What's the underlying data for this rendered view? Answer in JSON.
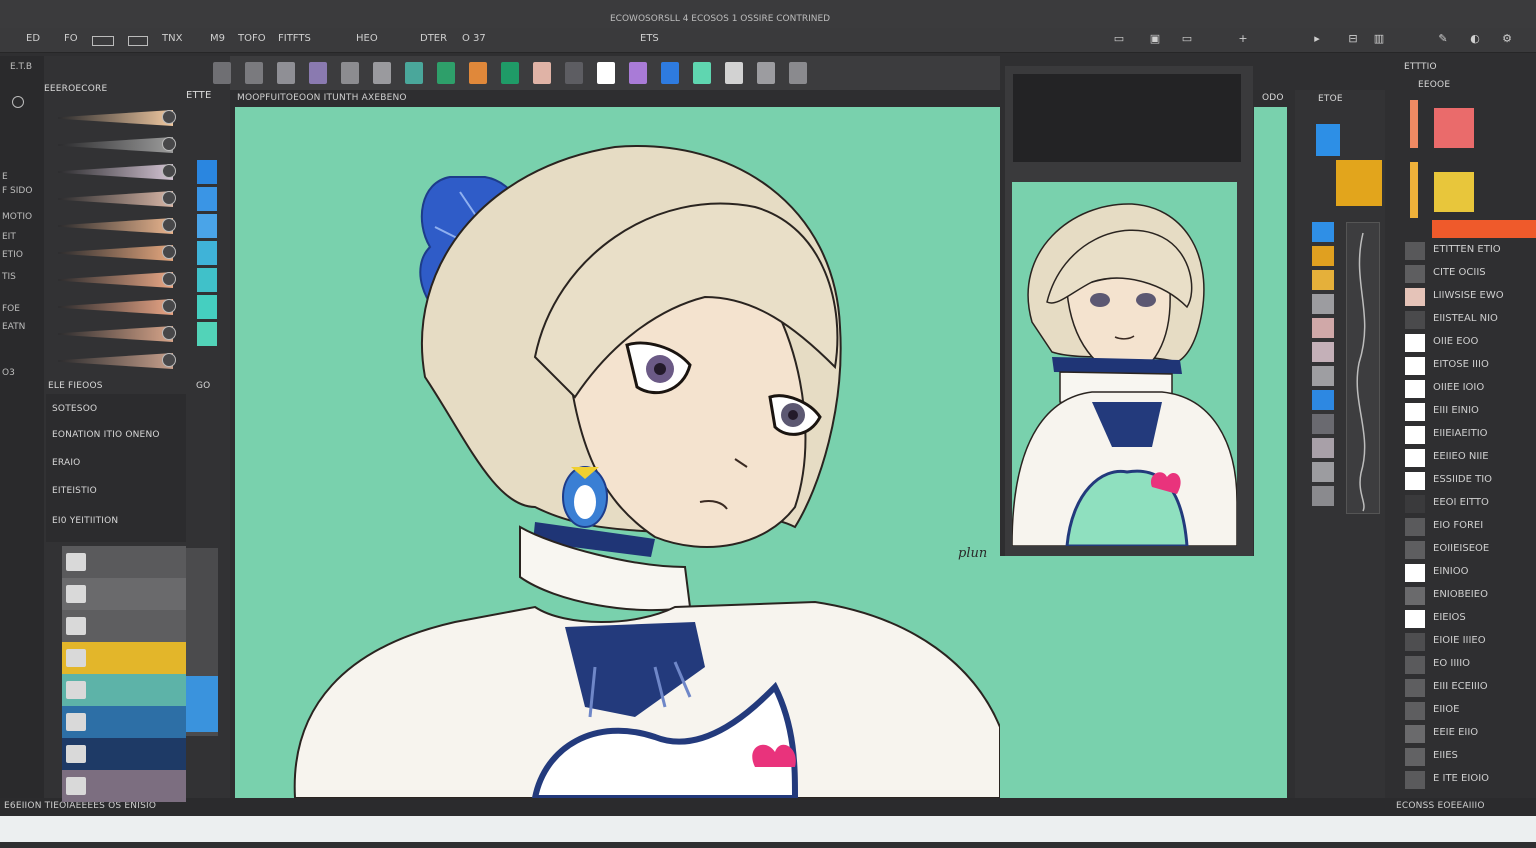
{
  "window": {
    "title": "ECOWOSORSLL 4 ECOSOS 1 OSSIRE CONTRINED"
  },
  "menu": [
    {
      "label": "ED"
    },
    {
      "label": "FO"
    },
    {
      "label": "TNX"
    },
    {
      "label": "M9"
    },
    {
      "label": "TOFO"
    },
    {
      "label": "FITFTS"
    },
    {
      "label": "HEO"
    },
    {
      "label": "DTER"
    },
    {
      "label": "O 37"
    },
    {
      "label": "ETS"
    }
  ],
  "swatches": [
    "#6f6f73",
    "#7a7a7e",
    "#8f8f95",
    "#8a7ab0",
    "#8c8c90",
    "#9a9a9e",
    "#4aa79b",
    "#2e9f6a",
    "#e0883a",
    "#1f9b67",
    "#e0b3a6",
    "#5d5d62",
    "#ffffff",
    "#a97bd7",
    "#2e7be0",
    "#5fd6b0",
    "#d2d2d2",
    "#9c9ca0",
    "#8a8a8e"
  ],
  "left_panel": {
    "header": "EEEROECORE",
    "brush_tab": "ETTE",
    "side_labels": [
      "E.T.B",
      "E",
      "F SIDO",
      "MOTIO",
      "EIT",
      "ETIO",
      "TIS",
      "FOE",
      "EATN",
      "O3"
    ],
    "brushes": [
      {
        "color": "#f0c8a0"
      },
      {
        "color": "#9c9c9c"
      },
      {
        "color": "#d3c3d3"
      },
      {
        "color": "#d8b6a6"
      },
      {
        "color": "#eab58e"
      },
      {
        "color": "#e5a77e"
      },
      {
        "color": "#eaa886"
      },
      {
        "color": "#e9a585"
      },
      {
        "color": "#d8a58a"
      },
      {
        "color": "#c7a08c"
      }
    ],
    "value_colors": [
      "#2a86e0",
      "#3a95e5",
      "#4aa4e8",
      "#3fb3d8",
      "#40c1c9",
      "#45cfc0",
      "#52d3b8"
    ],
    "section_title": "ELE FIEOOS",
    "section_value": "GO",
    "list_items": [
      "SOTESOO",
      "EONATION ITIO ONENO",
      "ERAIO",
      "EITEISTIO",
      "EI0 YEITIITION"
    ],
    "layers": [
      {
        "color": "#5a5a5c"
      },
      {
        "color": "#6a6a6c"
      },
      {
        "color": "#5e5e60"
      },
      {
        "color": "#e3b62a"
      },
      {
        "color": "#5db3a8"
      },
      {
        "color": "#2d6fa6"
      },
      {
        "color": "#1e3a66"
      },
      {
        "color": "#7c6e80"
      }
    ]
  },
  "canvas": {
    "doc_name": "MOOPFUITOEOON ITUNTH AXEBENO",
    "signature": "plun"
  },
  "reference_panel": {
    "label": "ODO"
  },
  "right_mid": {
    "header": "ETOE",
    "chips": [
      "#2f8fe6",
      "#e0a020",
      "#e5b03a",
      "#9c9ca0",
      "#d0a8a8",
      "#c4b0b8",
      "#9e9ea2",
      "#2d88e2",
      "#6a6a70",
      "#a8a0a8",
      "#9c9ca0",
      "#8a8a8e"
    ],
    "top_swatches": [
      "#2d8fe6",
      "#e2a51c"
    ]
  },
  "right_panel": {
    "header": "ETTTIO",
    "subheader": "EEOOE",
    "top_swatches": [
      "#ef8a63",
      "#ea6b6b",
      "#efb13a",
      "#e8c63b"
    ],
    "accent": "#ef5a2b",
    "items": [
      "ETITTEN ETIO",
      "CITE OCIIS",
      "LIIWSISE EWO",
      "EIISTEAL NIO",
      "OIIE EOO",
      "EITOSE IIIO",
      "OIIEE IOIO",
      "EIII EINIO",
      "EIIEIAEITIO",
      "EEIIEO NIIE",
      "ESSIIDE TIO",
      "EEOI EITTO",
      "EIO FOREI",
      "EOIIEISEOE",
      "EINIOO",
      "ENIOBEIEO",
      "EIEIOS",
      "EIOIE IIIEO",
      "EO IIIIO",
      "EIII ECEIIIO",
      "EIIOE",
      "EEIE EIIO",
      "EIIES",
      "E ITE EIOIO"
    ],
    "chips": [
      "#58585a",
      "#5e5e60",
      "#e5c3b8",
      "#4a4a4c",
      "#ffffff",
      "#ffffff",
      "#ffffff",
      "#ffffff",
      "#ffffff",
      "#ffffff",
      "#ffffff",
      "#3a3a3c",
      "#5a5a5c",
      "#5e5e60",
      "#ffffff",
      "#6a6a6c",
      "#ffffff",
      "#4e4e50",
      "#5a5a5c",
      "#5e5e60",
      "#5e5e60",
      "#6a6a6c",
      "#626264",
      "#5a5a5c"
    ]
  },
  "status": {
    "left": "E6EIION TIEOIAEEEES OS ENISIO",
    "right": "ECONSS EOEEAIIIO"
  }
}
